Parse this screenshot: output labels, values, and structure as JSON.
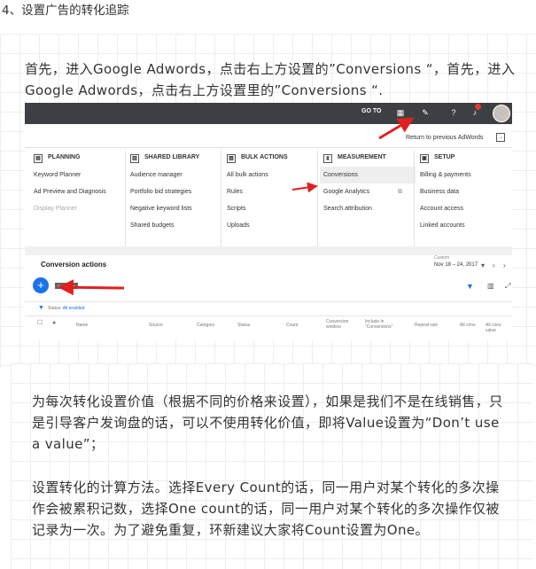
{
  "heading": "4、设置广告的转化追踪",
  "paragraphs": {
    "p1": "首先，进入Google Adwords，点击右上方设置的”Conversions “，首先，进入Google Adwords，点击右上方设置里的”Conversions “.",
    "p2": "为每次转化设置价值（根据不同的价格来设置），如果是我们不是在线销售，只是引导客户发询盘的话，可以不使用转化价值，即将Value设置为“Don’t use a value”；",
    "p3": "设置转化的计算方法。选择Every Count的话，同一用户对某个转化的多次操作会被累积记数，选择One count的话，同一用户对某个转化的多次操作仅被记录为一次。为了避免重复，环新建议大家将Count设置为One。"
  },
  "screenshot": {
    "topbar": {
      "goto": "GO TO",
      "icons": [
        "reports-icon",
        "wrench-icon",
        "help-icon",
        "bell-icon",
        "avatar"
      ],
      "bell_badge": "!"
    },
    "return_link": "Return to previous AdWords",
    "menus": [
      {
        "title": "PLANNING",
        "items": [
          "Keyword Planner",
          "Ad Preview and Diagnosis",
          "Display Planner"
        ]
      },
      {
        "title": "SHARED LIBRARY",
        "items": [
          "Audience manager",
          "Portfolio bid strategies",
          "Negative keyword lists",
          "Shared budgets"
        ]
      },
      {
        "title": "BULK ACTIONS",
        "items": [
          "All bulk actions",
          "Rules",
          "Scripts",
          "Uploads"
        ]
      },
      {
        "title": "MEASUREMENT",
        "items": [
          "Conversions",
          "Google Analytics",
          "Search attribution"
        ]
      },
      {
        "title": "SETUP",
        "items": [
          "Billing & payments",
          "Business data",
          "Account access",
          "Linked accounts"
        ]
      }
    ],
    "conversion_actions": {
      "title": "Conversion actions",
      "date_label": "Custom",
      "date_range": "Nov 18 – 24, 2017",
      "tag": "Conversion",
      "status_label": "Status:",
      "status_value": "All enabled",
      "columns": [
        "Name",
        "Source",
        "Category",
        "Status",
        "Count",
        "Conversion window",
        "Include in \"Conversions\"",
        "Repeat rate",
        "All conv.",
        "All conv. value"
      ]
    }
  }
}
